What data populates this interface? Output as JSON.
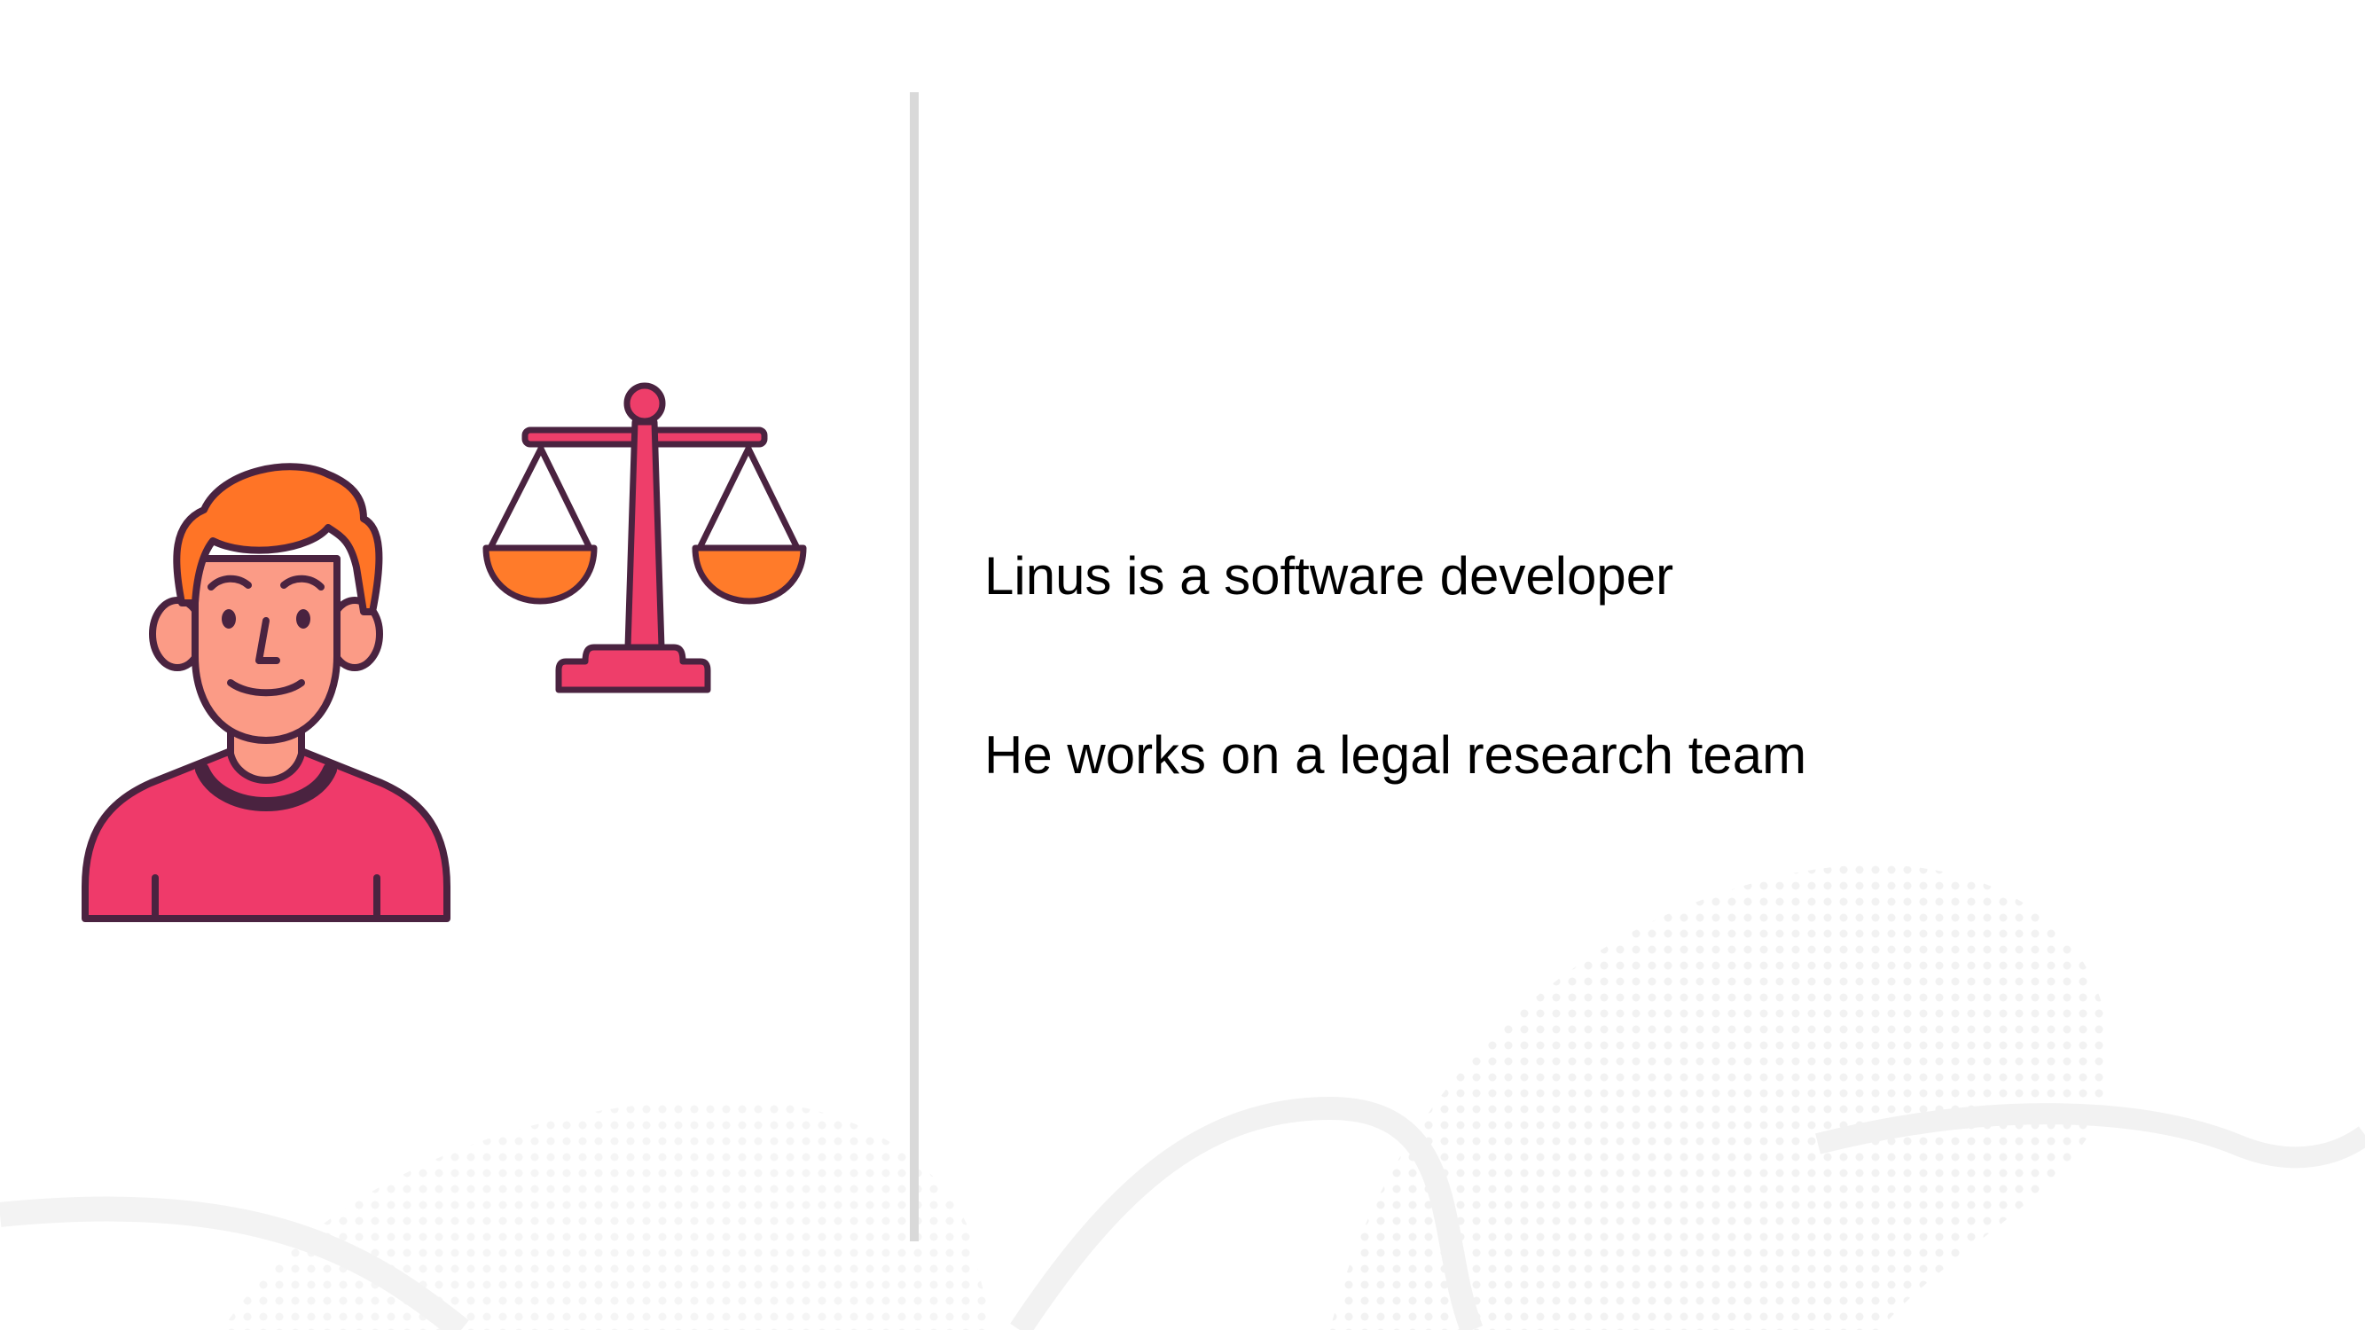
{
  "slide": {
    "lines": [
      "Linus is a software developer",
      "He works on a legal research team"
    ]
  },
  "illustrations": {
    "person_icon": "person-icon",
    "scales_icon": "scales-of-justice-icon"
  },
  "colors": {
    "outline": "#4a2340",
    "shirt": "#ef3a6a",
    "skin": "#fb9b86",
    "hair": "#ff7426",
    "scale_body": "#ee3e6a",
    "scale_pans": "#ff7b2a",
    "divider": "#d9d9d9"
  }
}
